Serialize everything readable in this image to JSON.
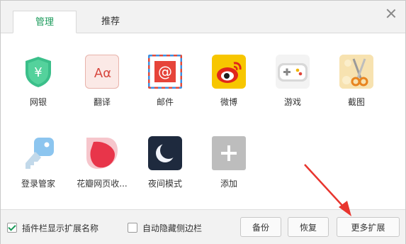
{
  "tabs": [
    {
      "label": "管理",
      "active": true
    },
    {
      "label": "推荐",
      "active": false
    }
  ],
  "extensions": [
    {
      "label": "网银",
      "icon": "shield-yuan-icon",
      "color": "#3bbf8a"
    },
    {
      "label": "翻译",
      "icon": "translate-icon",
      "color": "#e05a5a"
    },
    {
      "label": "邮件",
      "icon": "mail-icon",
      "color": "#e0453a"
    },
    {
      "label": "微博",
      "icon": "weibo-icon",
      "color": "#f5c400"
    },
    {
      "label": "游戏",
      "icon": "gamepad-icon",
      "color": "#bbbbbb"
    },
    {
      "label": "截图",
      "icon": "scissors-icon",
      "color": "#f3c968"
    },
    {
      "label": "登录管家",
      "icon": "key-icon",
      "color": "#7fb8e8"
    },
    {
      "label": "花瓣网页收...",
      "icon": "huaban-icon",
      "color": "#e83a4c"
    },
    {
      "label": "夜间模式",
      "icon": "moon-icon",
      "color": "#1e2a3e"
    },
    {
      "label": "添加",
      "icon": "plus-icon",
      "color": "#bdbdbd"
    }
  ],
  "footer": {
    "show_names_label": "插件栏显示扩展名称",
    "show_names_checked": true,
    "auto_hide_label": "自动隐藏侧边栏",
    "auto_hide_checked": false,
    "backup_label": "备份",
    "restore_label": "恢复",
    "more_label": "更多扩展"
  },
  "colors": {
    "accent": "#1a9a5a",
    "annotation_arrow": "#e8352e"
  }
}
